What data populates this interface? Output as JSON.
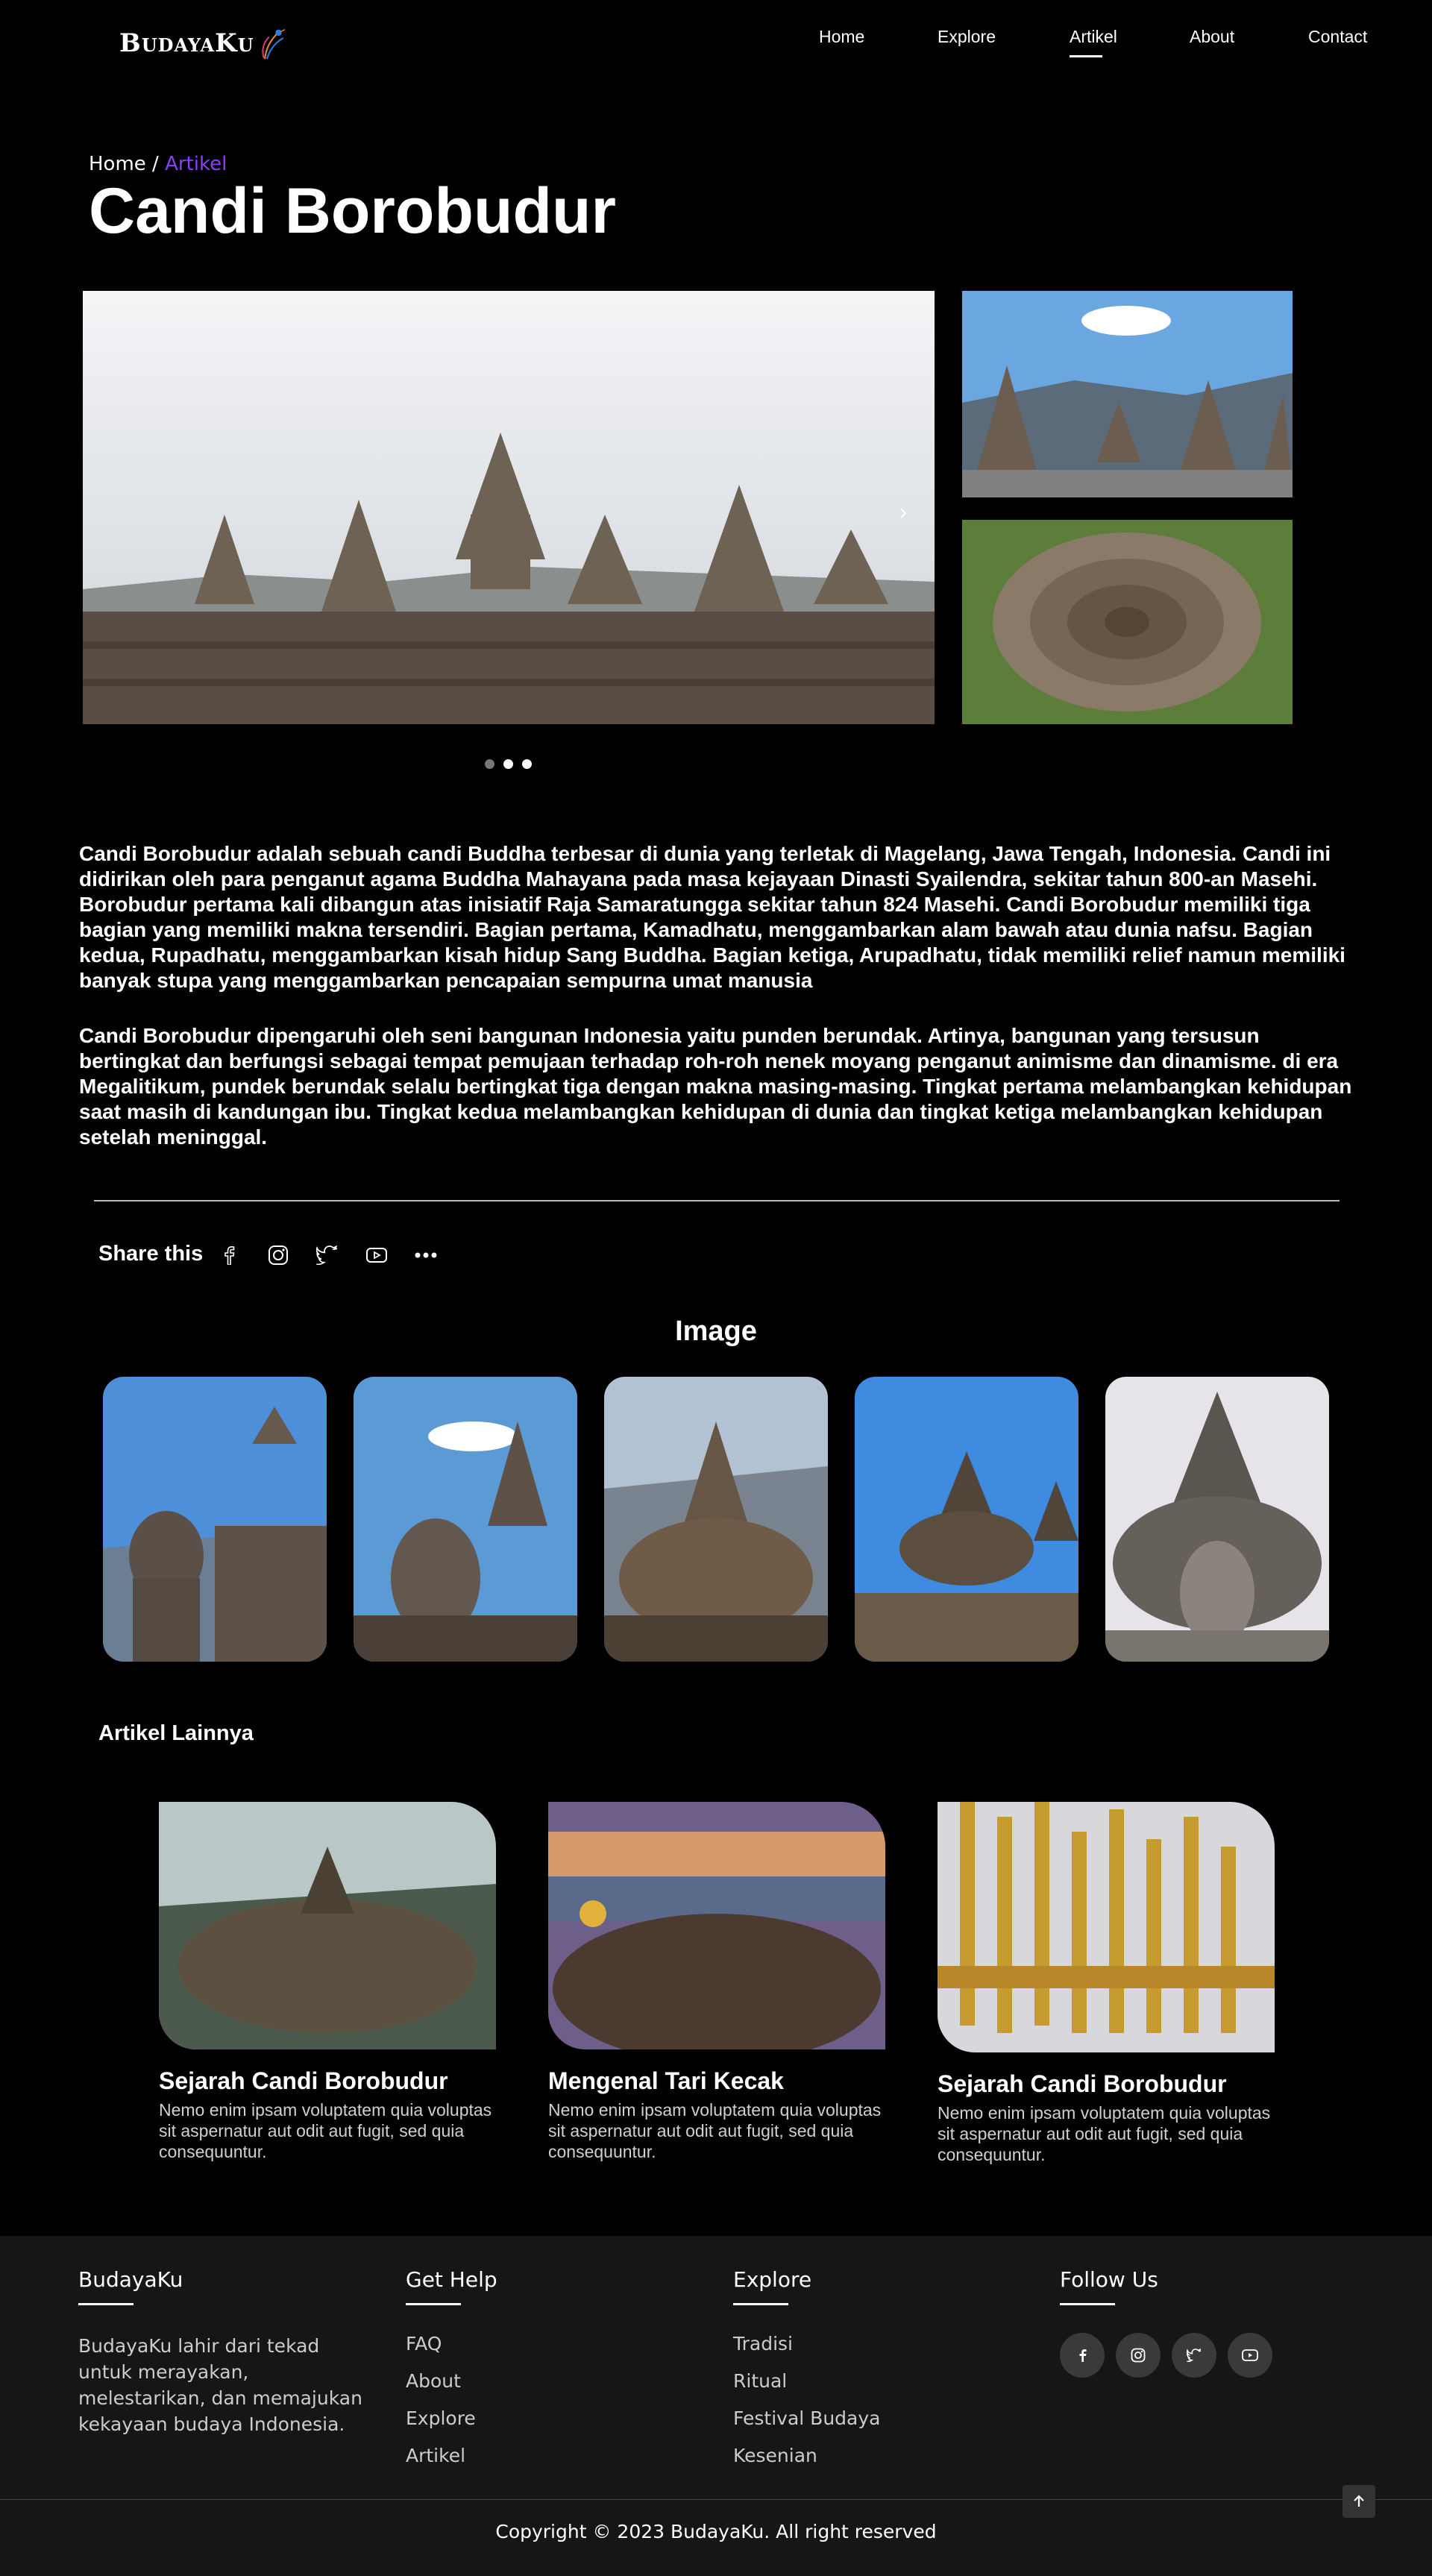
{
  "nav": {
    "brand": "BudayaKu",
    "items": [
      "Home",
      "Explore",
      "Artikel",
      "About",
      "Contact"
    ],
    "active": "Artikel"
  },
  "breadcrumb": {
    "home": "Home",
    "sep": "/",
    "current": "Artikel"
  },
  "page_title": "Candi Borobudur",
  "carousel": {
    "dots": 3,
    "active_dot": 1
  },
  "article": {
    "p1": "Candi Borobudur adalah sebuah candi Buddha terbesar di dunia yang terletak di Magelang, Jawa Tengah, Indonesia. Candi ini didirikan oleh para penganut agama Buddha Mahayana pada masa kejayaan Dinasti Syailendra, sekitar tahun 800-an Masehi. Borobudur pertama kali dibangun atas inisiatif Raja Samaratungga sekitar tahun 824 Masehi. Candi Borobudur memiliki tiga bagian yang memiliki makna tersendiri. Bagian pertama, Kamadhatu, menggambarkan alam bawah atau dunia nafsu. Bagian kedua, Rupadhatu, menggambarkan kisah hidup Sang Buddha. Bagian ketiga, Arupadhatu, tidak memiliki relief namun memiliki banyak stupa yang menggambarkan pencapaian sempurna umat manusia",
    "p2": "Candi Borobudur dipengaruhi oleh seni bangunan Indonesia yaitu punden berundak. Artinya, bangunan yang tersusun bertingkat dan berfungsi sebagai tempat pemujaan terhadap roh-roh nenek moyang penganut animisme dan dinamisme. di era Megalitikum, pundek berundak selalu bertingkat tiga dengan makna masing-masing. Tingkat pertama melambangkan kehidupan saat masih di kandungan ibu. Tingkat kedua melambangkan kehidupan di dunia dan tingkat ketiga melambangkan kehidupan setelah meninggal."
  },
  "share": {
    "label": "Share this",
    "icons": [
      "facebook-icon",
      "instagram-icon",
      "twitter-icon",
      "youtube-icon",
      "more-icon"
    ]
  },
  "gallery": {
    "title": "Image"
  },
  "related": {
    "title": "Artikel Lainnya",
    "cards": [
      {
        "title": "Sejarah Candi Borobudur",
        "desc": "Nemo enim ipsam voluptatem quia voluptas sit aspernatur aut odit aut fugit, sed quia consequuntur."
      },
      {
        "title": "Mengenal Tari Kecak",
        "desc": "Nemo enim ipsam voluptatem quia voluptas sit aspernatur aut odit aut fugit, sed quia consequuntur."
      },
      {
        "title": "Sejarah Candi Borobudur",
        "desc": "Nemo enim ipsam voluptatem quia voluptas sit aspernatur aut odit aut fugit, sed quia consequuntur."
      }
    ]
  },
  "footer": {
    "brand": "BudayaKu",
    "desc": "BudayaKu lahir dari tekad untuk merayakan, melestarikan, dan memajukan kekayaan budaya Indonesia.",
    "help_title": "Get Help",
    "help_links": [
      "FAQ",
      "About",
      "Explore",
      "Artikel"
    ],
    "explore_title": "Explore",
    "explore_links": [
      "Tradisi",
      "Ritual",
      "Festival Budaya",
      "Kesenian"
    ],
    "follow_title": "Follow Us",
    "copyright": "Copyright © 2023 BudayaKu. All right reserved"
  },
  "colors": {
    "accent": "#8a3ffc",
    "background": "#000000",
    "footer_bg": "#161616"
  }
}
